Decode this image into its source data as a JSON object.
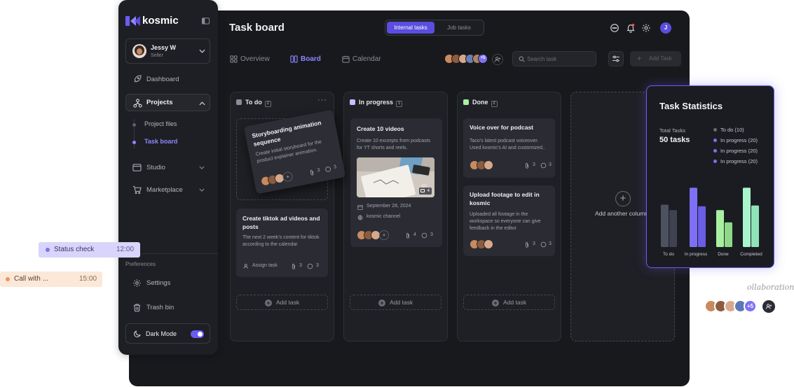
{
  "app": {
    "logo": "kosmic"
  },
  "user": {
    "name": "Jessy W",
    "role": "Seller",
    "initial": "J"
  },
  "sidebar": {
    "items": [
      {
        "label": "Dashboard",
        "icon": "rocket-icon"
      },
      {
        "label": "Projects",
        "icon": "projects-icon",
        "expanded": true
      },
      {
        "label": "Studio",
        "icon": "studio-icon"
      },
      {
        "label": "Marketplace",
        "icon": "cart-icon"
      }
    ],
    "subitems": [
      {
        "label": "Project files",
        "active": false
      },
      {
        "label": "Task board",
        "active": true
      }
    ],
    "preferences_label": "Preferences",
    "settings_label": "Settings",
    "trash_label": "Trash bin",
    "dark_mode_label": "Dark Mode",
    "dark_mode_on": true
  },
  "header": {
    "title": "Task board",
    "segments": [
      "Internal tasks",
      "Job tasks"
    ],
    "active_segment": "Internal tasks"
  },
  "nav_tabs": [
    {
      "label": "Overview",
      "active": false
    },
    {
      "label": "Board",
      "active": true
    },
    {
      "label": "Calendar",
      "active": false
    }
  ],
  "team": {
    "extra": "+5"
  },
  "search": {
    "placeholder": "Search task"
  },
  "toolbar": {
    "add_task": "Add Task"
  },
  "columns": [
    {
      "title": "To do",
      "count": "2",
      "color": "#8b8c95",
      "cards": [
        {
          "title": "Storyboarding animation sequence",
          "desc": "Create initial storyboard for the product explainer animation.",
          "attachments": "3",
          "comments": "3"
        },
        {
          "title": "Create tiktok ad videos and posts",
          "desc": "The next 2 week's content for tiktok according to the calendar",
          "assign": "Assign task",
          "attachments": "3",
          "comments": "3"
        }
      ],
      "add_label": "Add task"
    },
    {
      "title": "In progress",
      "count": "1",
      "color": "#c7bfff",
      "cards": [
        {
          "title": "Create 10 videos",
          "desc": "Create 10 excerpts from podcasts for YT shorts and reels.",
          "image_count": "4",
          "date": "September 28, 2024",
          "channel": "kosmic channel",
          "attachments": "4",
          "comments": "3"
        }
      ],
      "add_label": "Add task"
    },
    {
      "title": "Done",
      "count": "2",
      "color": "#a8f0a0",
      "cards": [
        {
          "title": "Voice over for podcast",
          "desc": "Taco's latest podcast voiceover. Used kosmic's AI and customized..",
          "attachments": "3",
          "comments": "3"
        },
        {
          "title": "Upload footage to edit in kosmic",
          "desc": "Uploaded all footage in the workspace so everyone can give feedback in the editor",
          "attachments": "3",
          "comments": "3"
        }
      ],
      "add_label": "Add task"
    }
  ],
  "add_column_label": "Add another column",
  "stats": {
    "title": "Task Statistics",
    "total_label": "Total Tasks",
    "total_value": "50 tasks",
    "legend": [
      {
        "label": "To do (10)",
        "color": "#6b6c75"
      },
      {
        "label": "In progress (20)",
        "color": "#7d70f4"
      },
      {
        "label": "In progress (20)",
        "color": "#7d70f4"
      },
      {
        "label": "In progress (20)",
        "color": "#7d70f4"
      }
    ]
  },
  "chart_data": {
    "type": "bar",
    "categories": [
      "To do",
      "In progress",
      "Done",
      "Completed"
    ],
    "series": [
      {
        "values": [
          55,
          77,
          48,
          77
        ]
      },
      {
        "values": [
          48,
          53,
          32,
          54
        ]
      }
    ],
    "colors": [
      [
        "#4d5260",
        "#3f4350"
      ],
      [
        "#7d70f4",
        "#6a5de6"
      ],
      [
        "#a8f0a0",
        "#8fd888"
      ],
      [
        "#a8f5cc",
        "#8fe3b7"
      ]
    ],
    "ylim": [
      0,
      80
    ]
  },
  "floating": {
    "status_check": {
      "label": "Status check",
      "time": "12:00"
    },
    "call": {
      "label": "Call with ...",
      "time": "15:00"
    },
    "collab_label": "ollaboration",
    "collab_extra": "+5"
  }
}
